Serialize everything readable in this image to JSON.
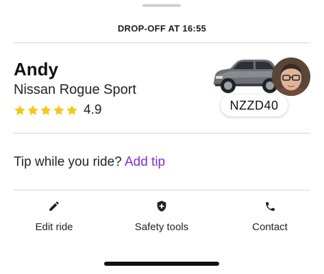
{
  "header": {
    "dropoff_label": "DROP-OFF AT 16:55"
  },
  "driver": {
    "name": "Andy",
    "car_model": "Nissan Rogue Sport",
    "rating": "4.9",
    "rating_stars": 5,
    "license_plate": "NZZD40"
  },
  "tip": {
    "prompt": "Tip while you ride?",
    "link_label": "Add tip"
  },
  "actions": [
    {
      "label": "Edit ride",
      "icon": "pencil-icon"
    },
    {
      "label": "Safety tools",
      "icon": "shield-icon"
    },
    {
      "label": "Contact",
      "icon": "phone-icon"
    }
  ],
  "colors": {
    "accent": "#7a2ed6",
    "star": "#f6c619",
    "divider": "#d6d6d9"
  }
}
